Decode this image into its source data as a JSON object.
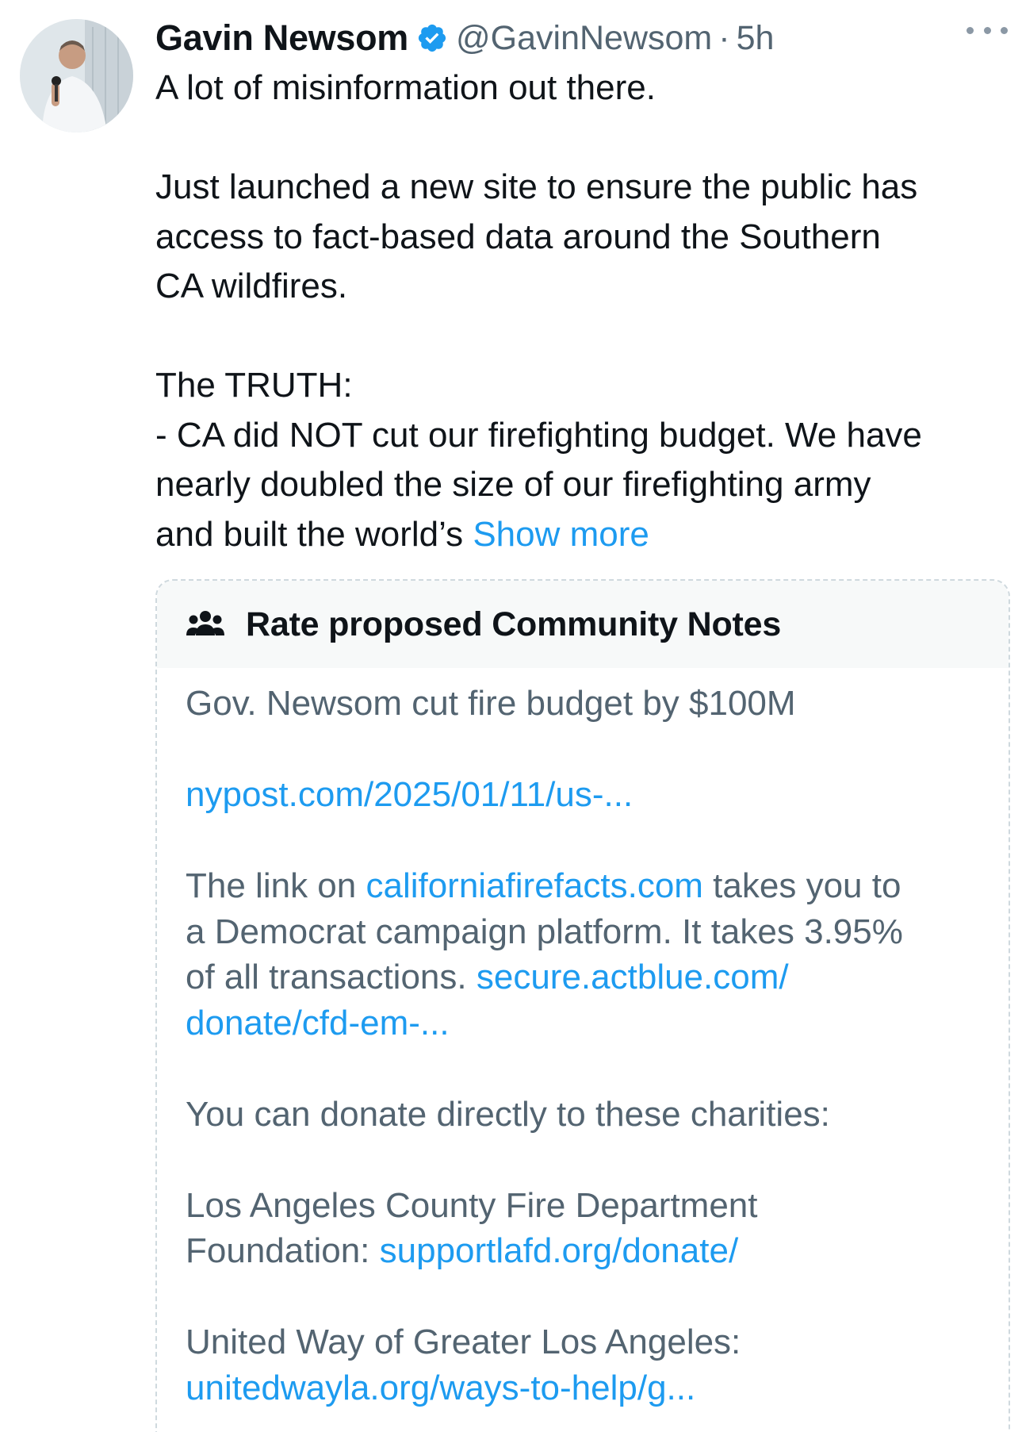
{
  "author": {
    "display_name": "Gavin Newsom",
    "handle": "@GavinNewsom",
    "separator": "·",
    "time": "5h",
    "verified": true,
    "verified_color": "#1d9bf0"
  },
  "tweet": {
    "lines": [
      "A lot of misinformation out there.",
      "",
      "Just launched a new site to ensure the public has",
      "access to fact-based data around the Southern",
      "CA wildfires.",
      "",
      "The TRUTH:",
      "- CA did NOT cut our firefighting budget. We have",
      "nearly doubled the size of our firefighting army"
    ],
    "last_line_text": "and built the world’s ",
    "show_more_label": "Show more"
  },
  "community_notes": {
    "title": "Rate proposed Community Notes",
    "note_headline": "Gov. Newsom cut fire budget by $100M",
    "nypost_link": "nypost.com/2025/01/11/us-...",
    "para1_prefix": "The link on ",
    "para1_link": "californiafirefacts.com",
    "para1_line1_suffix": " takes you to",
    "para1_line2": "a Democrat campaign platform. It takes 3.95%",
    "para1_line3_text": "of all transactions.  ",
    "actblue_link_line1": "secure.actblue.com/",
    "actblue_link_line2": "donate/cfd-em-...",
    "donate_intro": "You can donate directly to these charities:",
    "lafd_line1": "Los Angeles County Fire Department",
    "lafd_line2_prefix": "Foundation: ",
    "lafd_link": "supportlafd.org/donate/",
    "unitedway_label": "United Way of Greater Los Angeles:",
    "unitedway_link": "unitedwayla.org/ways-to-help/g..."
  },
  "colors": {
    "link": "#1d9bf0",
    "secondary_text": "#536471",
    "primary_text": "#0f1419",
    "notes_header_bg": "#f7f9f9"
  },
  "icons": {
    "avatar": "profile-photo",
    "verified": "verified-badge-icon",
    "more": "more-options-icon",
    "notes": "people-group-icon"
  }
}
